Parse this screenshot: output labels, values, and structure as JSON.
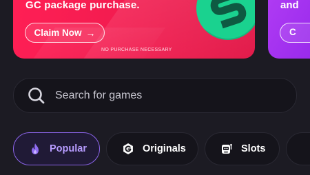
{
  "promo": {
    "headline": "GC package purchase.",
    "cta_label": "Claim Now",
    "cta_arrow": "→",
    "disclaimer": "NO PURCHASE NECESSARY",
    "coin_letter": "S"
  },
  "promo_secondary": {
    "headline": "and",
    "cta_label": "C"
  },
  "search": {
    "placeholder": "Search for games"
  },
  "categories": [
    {
      "label": "Popular",
      "icon": "flame-icon",
      "active": true
    },
    {
      "label": "Originals",
      "icon": "originals-g-icon",
      "active": false
    },
    {
      "label": "Slots",
      "icon": "slot-machine-icon",
      "active": false
    }
  ],
  "colors": {
    "background": "#1c1b23",
    "promo_red": "#ff1f55",
    "promo_purple": "#9a2cec",
    "coin_green": "#1ad28f",
    "active_chip_border": "#8a63e8",
    "active_chip_text": "#b79cff"
  }
}
